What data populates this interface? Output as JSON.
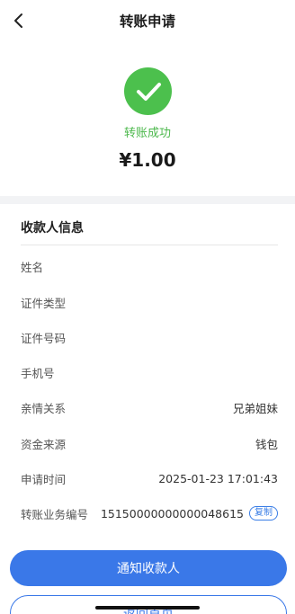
{
  "header": {
    "title": "转账申请",
    "back_icon": "chevron-left-icon"
  },
  "result": {
    "icon": "check-circle-icon",
    "icon_color": "#4cc04d",
    "status": "转账成功",
    "amount": "¥1.00"
  },
  "payee": {
    "title": "收款人信息",
    "rows": [
      {
        "label": "姓名",
        "value": ""
      },
      {
        "label": "证件类型",
        "value": ""
      },
      {
        "label": "证件号码",
        "value": ""
      },
      {
        "label": "手机号",
        "value": ""
      },
      {
        "label": "亲情关系",
        "value": "兄弟姐妹"
      },
      {
        "label": "资金来源",
        "value": "钱包"
      },
      {
        "label": "申请时间",
        "value": "2025-01-23 17:01:43"
      },
      {
        "label": "转账业务编号",
        "value": "15150000000000048615",
        "action": "复制"
      }
    ]
  },
  "buttons": {
    "primary": "通知收款人",
    "secondary": "返回首页"
  },
  "colors": {
    "accent": "#3a78e8",
    "success": "#4cc04d"
  }
}
